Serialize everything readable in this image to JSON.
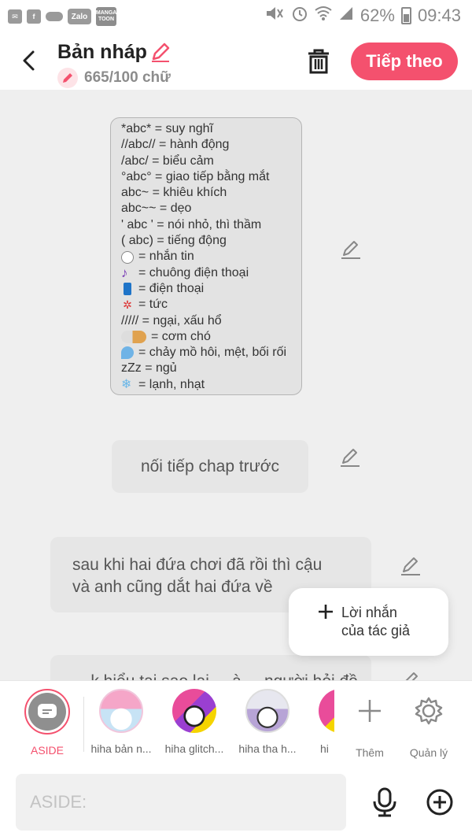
{
  "status_bar": {
    "zalo_label": "Zalo",
    "manga_label": "MANGA TOON",
    "battery": "62%",
    "time": "09:43"
  },
  "header": {
    "title": "Bản nháp",
    "word_count": "665/100 chữ",
    "next_label": "Tiếp theo",
    "accent_color": "#f4516e"
  },
  "legend": [
    {
      "text": "*abc* = suy nghĩ"
    },
    {
      "text": "//abc// = hành động"
    },
    {
      "text": "/abc/ = biểu cảm"
    },
    {
      "text": "°abc° = giao tiếp bằng mắt"
    },
    {
      "text": "abc~ = khiêu khích"
    },
    {
      "text": "abc~~ = dẹo"
    },
    {
      "text": "' abc ' = nói nhỏ, thì thầm"
    },
    {
      "text": "( abc) = tiếng động"
    },
    {
      "text": "= nhắn tin",
      "icon": "speech-bubble-icon"
    },
    {
      "text": "= chuông điện thoại",
      "icon": "music-note-icon"
    },
    {
      "text": "= điện thoại",
      "icon": "phone-icon"
    },
    {
      "text": "= tức",
      "icon": "anger-icon"
    },
    {
      "text": "///// = ngại, xấu hổ"
    },
    {
      "text": "= cơm chó",
      "icon": "rice-dog-icon"
    },
    {
      "text": "= chảy mồ hôi, mệt, bối rối",
      "icon": "sweat-drop-icon"
    },
    {
      "text": "zZz = ngủ"
    },
    {
      "text": "= lạnh, nhạt",
      "icon": "snowflake-icon"
    }
  ],
  "messages": {
    "m1": "nối tiếp chap trước",
    "m2_line1": "sau khi hai đứa chơi đã rồi thì cậu",
    "m2_line2": "và anh cũng dắt hai đứa về",
    "m3_partial": "... k hiểu tại sao lại ... à ... người hỏi đồ ..."
  },
  "popup": {
    "label_line1": "Lời nhắn",
    "label_line2": "của tác giả"
  },
  "characters": [
    {
      "name": "ASIDE"
    },
    {
      "name": "hiha bản n..."
    },
    {
      "name": "hiha glitch..."
    },
    {
      "name": "hiha tha h..."
    },
    {
      "name": "hi"
    }
  ],
  "tools": {
    "add_label": "Thêm",
    "manage_label": "Quản lý"
  },
  "input": {
    "placeholder": "ASIDE:"
  }
}
